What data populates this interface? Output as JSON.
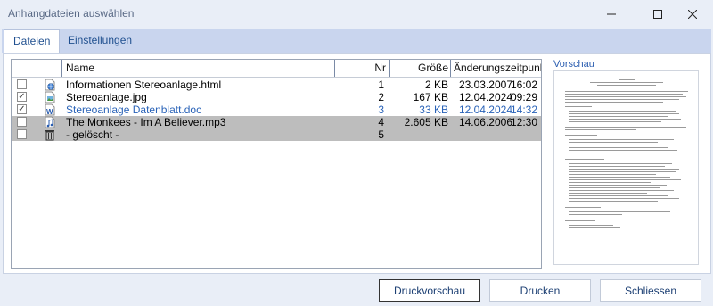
{
  "window": {
    "title": "Anhangdateien auswählen"
  },
  "icons": {
    "minimize": "minimize-icon",
    "maximize": "maximize-icon",
    "close": "close-icon"
  },
  "tabs": [
    {
      "label": "Dateien",
      "active": true
    },
    {
      "label": "Einstellungen",
      "active": false
    }
  ],
  "list": {
    "columns": {
      "name": "Name",
      "nr": "Nr",
      "size": "Größe",
      "modified": "Änderungszeitpunkt"
    },
    "rows": [
      {
        "checked": false,
        "icon": "web-page-icon",
        "name": "Informationen Stereoanlage.html",
        "nr": "1",
        "size": "2 KB",
        "date": "23.03.2007",
        "time": "16:02",
        "style": "normal"
      },
      {
        "checked": true,
        "icon": "image-file-icon",
        "name": "Stereoanlage.jpg",
        "nr": "2",
        "size": "167 KB",
        "date": "12.04.2024",
        "time": "09:29",
        "style": "normal"
      },
      {
        "checked": true,
        "icon": "word-document-icon",
        "name": "Stereoanlage Datenblatt.doc",
        "nr": "3",
        "size": "33 KB",
        "date": "12.04.2024",
        "time": "14:32",
        "style": "blue"
      },
      {
        "checked": false,
        "icon": "audio-file-icon",
        "name": "The Monkees - Im A Believer.mp3",
        "nr": "4",
        "size": "2.605 KB",
        "date": "14.06.2006",
        "time": "12:30",
        "style": "selected"
      },
      {
        "checked": false,
        "icon": "trash-icon",
        "name": "- gelöscht -",
        "nr": "5",
        "size": "",
        "date": "",
        "time": "",
        "style": "selected"
      }
    ]
  },
  "preview": {
    "label": "Vorschau"
  },
  "buttons": {
    "print_preview": "Druckvorschau",
    "print": "Drucken",
    "close": "Schliessen"
  },
  "colors": {
    "accent": "#1f4f8f",
    "selection": "#bdbdbd",
    "blue_text": "#2a63b8",
    "tabbar": "#c9d5ee"
  }
}
